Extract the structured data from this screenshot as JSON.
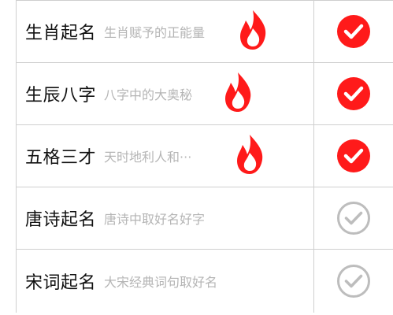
{
  "items": [
    {
      "title": "生肖起名",
      "subtitle": "生肖赋予的正能量",
      "hot": true,
      "hot_icon": "flame-icon",
      "selected": true,
      "check_icon": "check-circle-filled-icon"
    },
    {
      "title": "生辰八字",
      "subtitle": "八字中的大奥秘",
      "hot": true,
      "hot_icon": "flame-icon",
      "selected": true,
      "check_icon": "check-circle-filled-icon"
    },
    {
      "title": "五格三才",
      "subtitle": "天时地利人和···",
      "hot": true,
      "hot_icon": "flame-icon",
      "selected": true,
      "check_icon": "check-circle-filled-icon"
    },
    {
      "title": "唐诗起名",
      "subtitle": "唐诗中取好名好字",
      "hot": false,
      "selected": false,
      "check_icon": "check-circle-outline-icon"
    },
    {
      "title": "宋词起名",
      "subtitle": "大宋经典词句取好名",
      "hot": false,
      "selected": false,
      "check_icon": "check-circle-outline-icon"
    }
  ],
  "colors": {
    "accent": "#ff1a1a",
    "unselected": "#bdbdbd",
    "title_text": "#111111",
    "subtitle_text": "#b5b5b5",
    "divider": "#cfcfcf"
  }
}
